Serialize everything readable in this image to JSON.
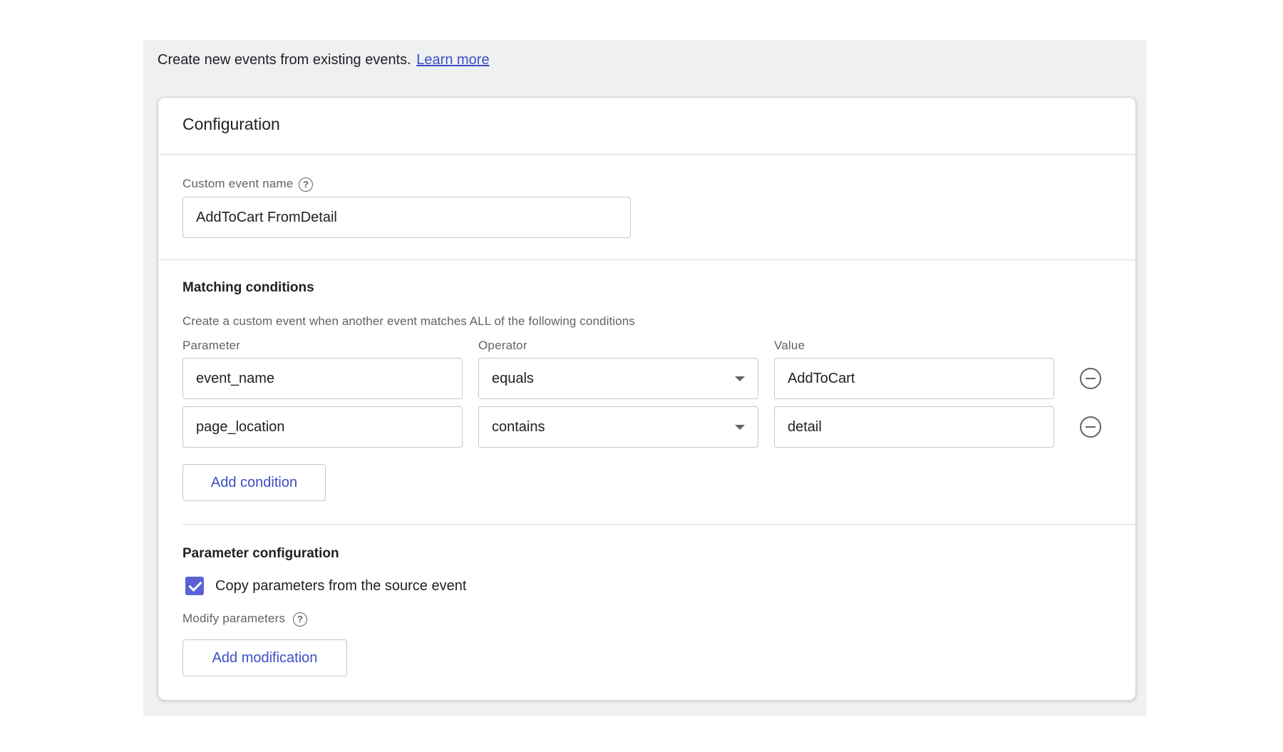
{
  "intro": {
    "text": "Create new events from existing events.",
    "link": "Learn more"
  },
  "card": {
    "title": "Configuration"
  },
  "custom_event": {
    "label": "Custom event name",
    "help_icon": "help-circle-icon",
    "value": "AddToCart FromDetail"
  },
  "matching": {
    "title": "Matching conditions",
    "description": "Create a custom event when another event matches ALL of the following conditions",
    "headers": {
      "parameter": "Parameter",
      "operator": "Operator",
      "value": "Value"
    },
    "conditions": [
      {
        "parameter": "event_name",
        "operator": "equals",
        "value": "AddToCart"
      },
      {
        "parameter": "page_location",
        "operator": "contains",
        "value": "detail"
      }
    ],
    "add_button": "Add condition",
    "remove_icon": "remove-circle-icon"
  },
  "param_config": {
    "title": "Parameter configuration",
    "copy_checkbox_label": "Copy parameters from the source event",
    "copy_checked": true,
    "modify_label": "Modify parameters",
    "add_button": "Add modification"
  },
  "colors": {
    "accent": "#3c4ec5",
    "checkbox": "#5a62d6",
    "panel_bg": "#eef0f2"
  }
}
